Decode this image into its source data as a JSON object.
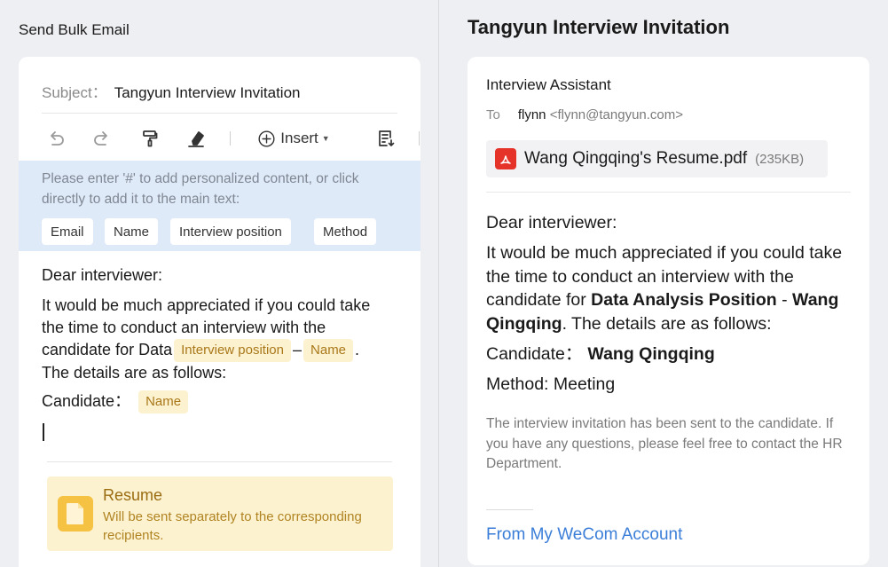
{
  "compose": {
    "title": "Send Bulk Email",
    "subject_label": "Subject：",
    "subject_value": "Tangyun Interview Invitation",
    "toolbar": {
      "undo_icon": "undo-icon",
      "redo_icon": "redo-icon",
      "format_painter_icon": "format-painter-icon",
      "eraser_icon": "eraser-icon",
      "insert_label": "Insert",
      "template_icon": "template-icon"
    },
    "hint": {
      "text": "Please enter '#' to add personalized content, or click directly to add it to the main text:",
      "chips": [
        "Email",
        "Name",
        "Interview position",
        "Method"
      ]
    },
    "body": {
      "greeting": "Dear interviewer:",
      "line1": "It would be much appreciated if you could take",
      "line2": "the time to conduct an interview with the",
      "line3_prefix": "candidate for Data",
      "tag_position": "Interview position",
      "dash": "–",
      "tag_name": "Name",
      "line3_suffix": ".",
      "line4": "The details are as follows:",
      "candidate_label": "Candidate：",
      "candidate_tag": "Name"
    },
    "resume": {
      "icon": "file-icon",
      "title": "Resume",
      "subtitle": "Will be sent separately to the corresponding recipients."
    }
  },
  "preview": {
    "title": "Tangyun Interview Invitation",
    "sender": "Interview Assistant",
    "to_label": "To",
    "to_name": "flynn",
    "to_email": "<flynn@tangyun.com>",
    "attachment": {
      "icon": "pdf-icon",
      "name": "Wang Qingqing's Resume.pdf",
      "size": "(235KB)"
    },
    "greeting": "Dear interviewer:",
    "body_prefix": "It would be much appreciated if you could take the time to conduct an interview with the candidate for ",
    "position": "Data Analysis Position",
    "dash": " - ",
    "name": "Wang Qingqing",
    "body_suffix": ". The details are as follows:",
    "candidate_label": "Candidate：",
    "candidate_name": "Wang Qingqing",
    "method_line": "Method: Meeting",
    "note": "The interview invitation has been sent to the candidate. If you have any questions, please feel free to contact the HR Department.",
    "footer_link": "From My WeCom Account"
  },
  "colors": {
    "accent_blue": "#3b7ed8",
    "hint_bg": "#dfeaf9",
    "tag_bg": "#fdf2cf",
    "tag_text": "#a9781a",
    "pdf_red": "#e5332a"
  }
}
